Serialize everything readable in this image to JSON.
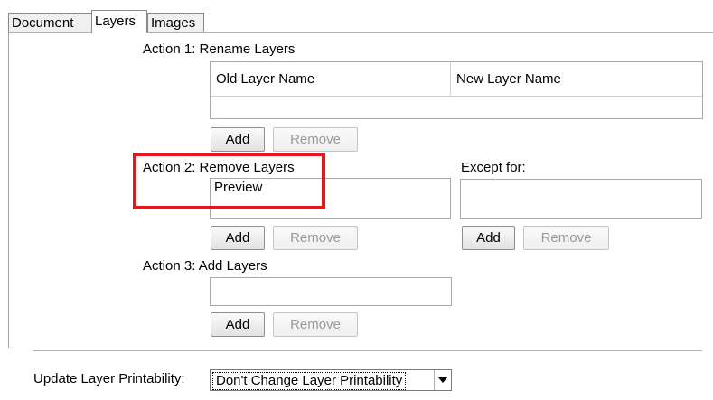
{
  "tabs": [
    {
      "label": "Document"
    },
    {
      "label": "Layers"
    },
    {
      "label": "Images"
    }
  ],
  "action1": {
    "label": "Action 1: Rename Layers",
    "columns": [
      "Old Layer Name",
      "New Layer Name"
    ],
    "add_label": "Add",
    "remove_label": "Remove"
  },
  "action2": {
    "label": "Action 2: Remove Layers",
    "items": [
      "Preview"
    ],
    "add_label": "Add",
    "remove_label": "Remove",
    "except": {
      "label": "Except for:",
      "add_label": "Add",
      "remove_label": "Remove"
    }
  },
  "action3": {
    "label": "Action 3: Add Layers",
    "add_label": "Add",
    "remove_label": "Remove"
  },
  "printability": {
    "label": "Update Layer Printability:",
    "selected": "Don't Change Layer Printability"
  },
  "colors": {
    "highlight": "#e3171f"
  }
}
